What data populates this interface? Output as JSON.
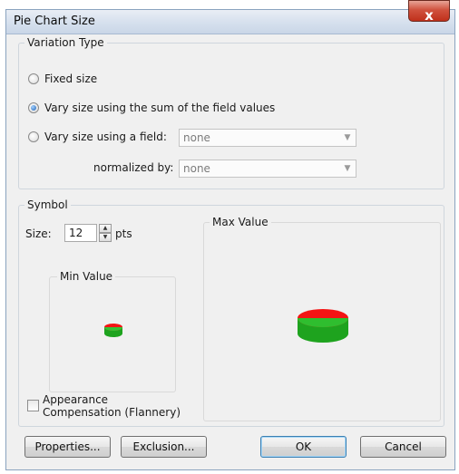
{
  "window": {
    "title": "Pie Chart Size",
    "close_glyph": "x"
  },
  "variation": {
    "group_label": "Variation Type",
    "options": [
      {
        "label": "Fixed size",
        "checked": false
      },
      {
        "label": "Vary size using the sum of the field values",
        "checked": true
      },
      {
        "label": "Vary size using a field:",
        "checked": false
      }
    ],
    "field_value": "none",
    "normalized_label": "normalized by:",
    "normalized_value": "none"
  },
  "symbol": {
    "group_label": "Symbol",
    "size_label": "Size:",
    "size_value": "12",
    "size_unit": "pts",
    "min_label": "Min Value",
    "max_label": "Max Value",
    "appearance_label_line1": "Appearance",
    "appearance_label_line2": "Compensation (Flannery)",
    "appearance_checked": false
  },
  "buttons": {
    "properties": "Properties...",
    "exclusion": "Exclusion...",
    "ok": "OK",
    "cancel": "Cancel"
  },
  "colors": {
    "pie_top": "#f41414",
    "pie_green": "#1ea31e",
    "accent": "#3c7fb1"
  }
}
